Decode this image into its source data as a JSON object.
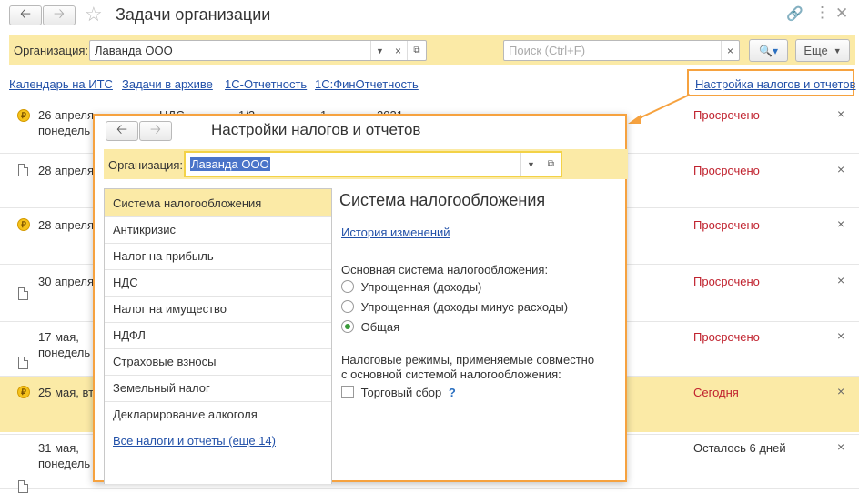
{
  "window": {
    "title": "Задачи организации"
  },
  "filter": {
    "org_label": "Организация:",
    "org_value": "Лаванда ООО",
    "search_placeholder": "Поиск (Ctrl+F)",
    "more_label": "Еще"
  },
  "links": [
    "Календарь на ИТС",
    "Задачи в архиве",
    "1С-Отчетность",
    "1С:ФинОтчетность",
    "Настройка налогов и отчетов"
  ],
  "tasks": [
    {
      "date": "26 апреля",
      "day": "понедель",
      "col2": "НДС",
      "col3": "1/2",
      "col4": "1",
      "col5": "2021",
      "status": "Просрочено"
    },
    {
      "date": "28 апреля",
      "status": "Просрочено"
    },
    {
      "date": "28 апреля",
      "status": "Просрочено"
    },
    {
      "date": "30 апреля",
      "status": "Просрочено"
    },
    {
      "date": "17 мая,",
      "day": "понедель",
      "status": "Просрочено"
    },
    {
      "date": "25 мая, вт",
      "status": "Сегодня"
    },
    {
      "date": "31 мая,",
      "day": "понедель",
      "status": "Осталось 6 дней"
    }
  ],
  "dialog": {
    "title": "Настройки налогов и отчетов",
    "org_label": "Организация:",
    "org_value": "Лаванда ООО",
    "nav": [
      "Система налогообложения",
      "Антикризис",
      "Налог на прибыль",
      "НДС",
      "Налог на имущество",
      "НДФЛ",
      "Страховые взносы",
      "Земельный налог",
      "Декларирование алкоголя"
    ],
    "nav_more": "Все налоги и отчеты (еще 14)",
    "section_title": "Система налогообложения",
    "history_link": "История изменений",
    "main_system_label": "Основная система налогообложения:",
    "options": [
      "Упрощенная (доходы)",
      "Упрощенная (доходы минус расходы)",
      "Общая"
    ],
    "selected_option": "Общая",
    "regimes_label_1": "Налоговые режимы, применяемые совместно",
    "regimes_label_2": "с основной системой налогообложения:",
    "trade_fee_label": "Торговый сбор",
    "trade_fee_checked": false,
    "help_mark": "?"
  },
  "colors": {
    "accent_yellow": "#fbeaa6",
    "highlight": "#f6a23f",
    "overdue": "#c0222e",
    "link": "#2150a8"
  }
}
